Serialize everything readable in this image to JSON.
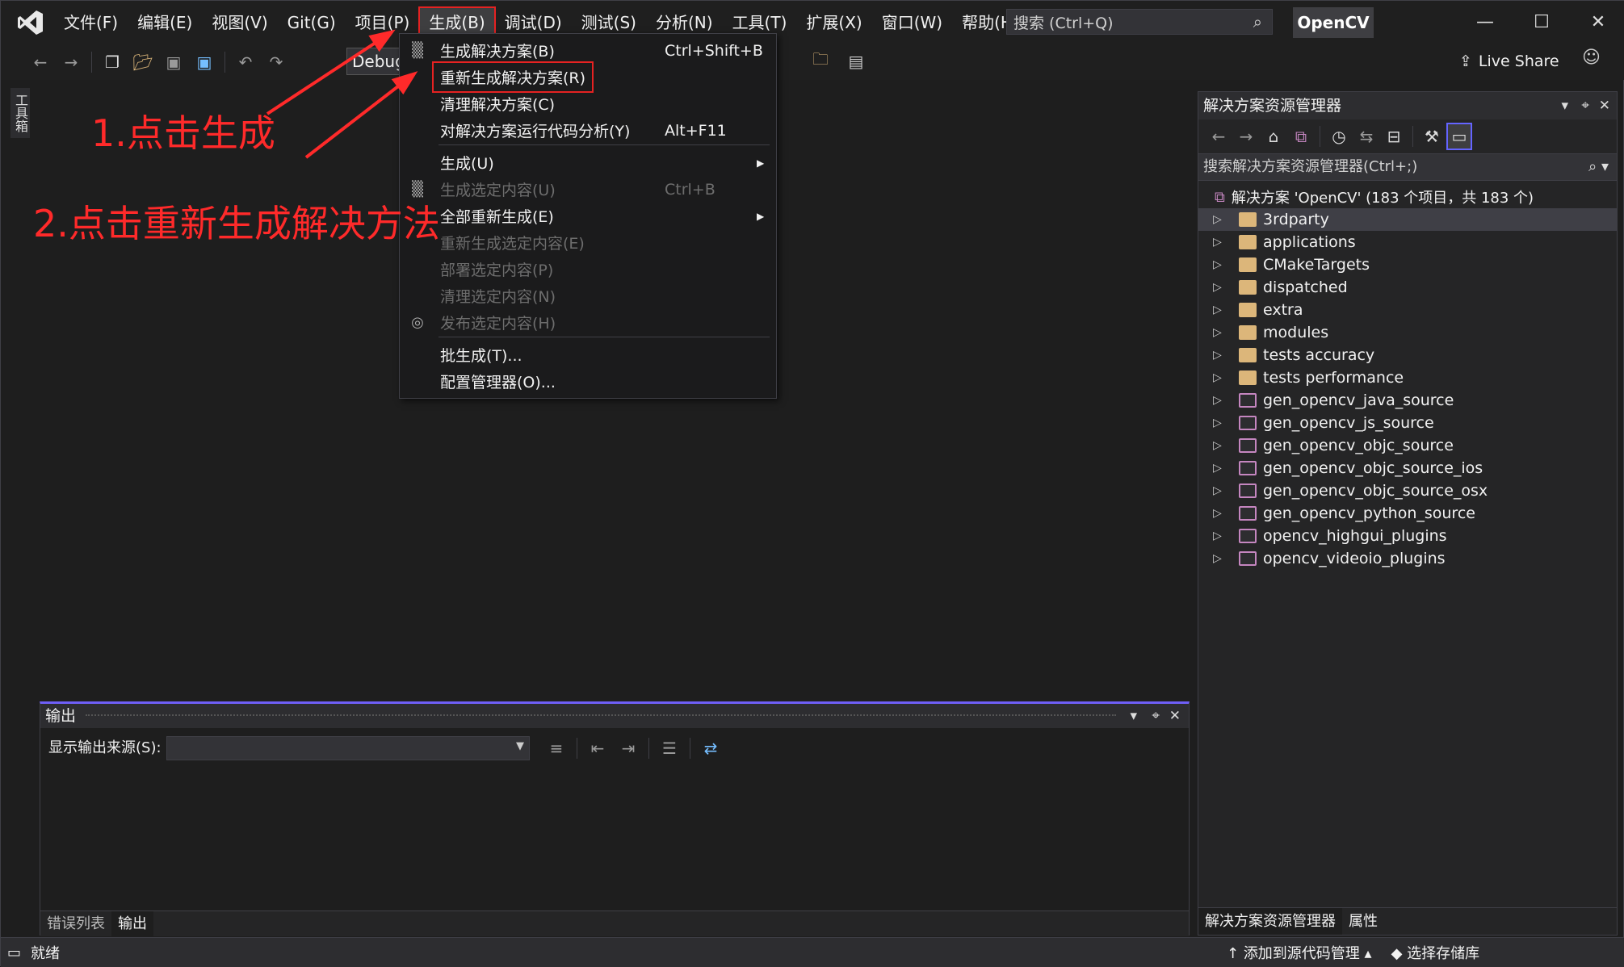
{
  "app": {
    "solution_badge": "OpenCV"
  },
  "menubar": {
    "items": [
      "文件(F)",
      "编辑(E)",
      "视图(V)",
      "Git(G)",
      "项目(P)",
      "生成(B)",
      "调试(D)",
      "测试(S)",
      "分析(N)",
      "工具(T)",
      "扩展(X)",
      "窗口(W)",
      "帮助(H)"
    ],
    "active_index": 5,
    "search_placeholder": "搜索 (Ctrl+Q)"
  },
  "toolbar": {
    "config": "Debug",
    "live_share": "Live Share"
  },
  "left_rail": {
    "toolbox": "工具箱"
  },
  "dropdown": {
    "items": [
      {
        "label": "生成解决方案(B)",
        "shortcut": "Ctrl+Shift+B",
        "disabled": false,
        "icon": "build-icon"
      },
      {
        "label": "重新生成解决方案(R)",
        "shortcut": "",
        "disabled": false,
        "highlight": true
      },
      {
        "label": "清理解决方案(C)",
        "shortcut": "",
        "disabled": false
      },
      {
        "label": "对解决方案运行代码分析(Y)",
        "shortcut": "Alt+F11",
        "disabled": false
      },
      {
        "label": "生成(U)",
        "shortcut": "",
        "disabled": false,
        "submenu": true
      },
      {
        "label": "生成选定内容(U)",
        "shortcut": "Ctrl+B",
        "disabled": true,
        "icon": "build-icon"
      },
      {
        "label": "全部重新生成(E)",
        "shortcut": "",
        "disabled": false,
        "submenu": true
      },
      {
        "label": "重新生成选定内容(E)",
        "shortcut": "",
        "disabled": true
      },
      {
        "label": "部署选定内容(P)",
        "shortcut": "",
        "disabled": true
      },
      {
        "label": "清理选定内容(N)",
        "shortcut": "",
        "disabled": true
      },
      {
        "label": "发布选定内容(H)",
        "shortcut": "",
        "disabled": true,
        "icon": "globe-icon"
      },
      {
        "label": "批生成(T)...",
        "shortcut": "",
        "disabled": false
      },
      {
        "label": "配置管理器(O)...",
        "shortcut": "",
        "disabled": false
      }
    ]
  },
  "annotations": {
    "step1": "1.点击生成",
    "step2": "2.点击重新生成解决方法",
    "color": "#ff2a2a"
  },
  "solution_explorer": {
    "title": "解决方案资源管理器",
    "search_placeholder": "搜索解决方案资源管理器(Ctrl+;)",
    "root": "解决方案 'OpenCV' (183 个项目，共 183 个)",
    "items": [
      {
        "name": "3rdparty",
        "type": "folder",
        "selected": true
      },
      {
        "name": "applications",
        "type": "folder"
      },
      {
        "name": "CMakeTargets",
        "type": "folder"
      },
      {
        "name": "dispatched",
        "type": "folder"
      },
      {
        "name": "extra",
        "type": "folder"
      },
      {
        "name": "modules",
        "type": "folder"
      },
      {
        "name": "tests accuracy",
        "type": "folder"
      },
      {
        "name": "tests performance",
        "type": "folder"
      },
      {
        "name": "gen_opencv_java_source",
        "type": "project"
      },
      {
        "name": "gen_opencv_js_source",
        "type": "project"
      },
      {
        "name": "gen_opencv_objc_source",
        "type": "project"
      },
      {
        "name": "gen_opencv_objc_source_ios",
        "type": "project"
      },
      {
        "name": "gen_opencv_objc_source_osx",
        "type": "project"
      },
      {
        "name": "gen_opencv_python_source",
        "type": "project"
      },
      {
        "name": "opencv_highgui_plugins",
        "type": "project"
      },
      {
        "name": "opencv_videoio_plugins",
        "type": "project"
      }
    ],
    "tabs": [
      "解决方案资源管理器",
      "属性"
    ]
  },
  "output": {
    "title": "输出",
    "source_label": "显示输出来源(S):",
    "tabs": [
      "错误列表",
      "输出"
    ]
  },
  "status": {
    "ready": "就绪",
    "source_control": "添加到源代码管理",
    "repo": "选择存储库"
  }
}
